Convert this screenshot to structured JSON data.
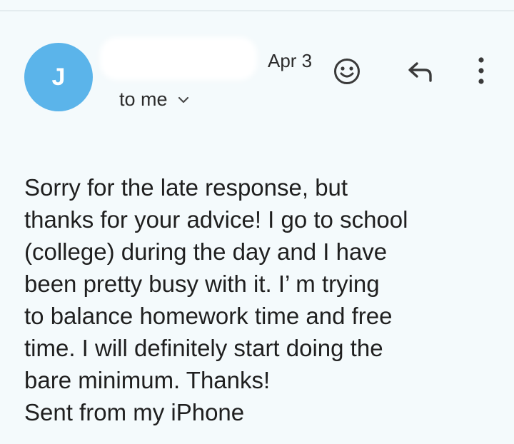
{
  "header": {
    "avatar_letter": "J",
    "date": "Apr 3",
    "recipient_label": "to me"
  },
  "icons": {
    "emoji": "smiley-face-icon",
    "reply": "reply-arrow-icon",
    "more": "vertical-dots-icon",
    "expand": "chevron-down-icon"
  },
  "colors": {
    "avatar": "#5bb4ea",
    "background": "#f4fafc"
  },
  "message": {
    "lines": [
      "Sorry for the late response, but",
      "thanks for your advice! I go to school",
      "(college) during the day and I have",
      "been pretty busy with it. I’ m trying",
      "to balance homework time and free",
      "time. I will definitely start doing the",
      "bare minimum. Thanks!",
      "Sent from my iPhone"
    ]
  }
}
